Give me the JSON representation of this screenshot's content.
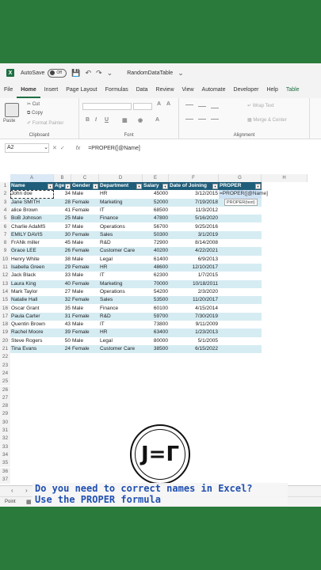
{
  "titlebar": {
    "autosave_label": "AutoSave",
    "autosave_state": "Off",
    "filename": "RandomDataTable"
  },
  "menu": {
    "tabs": [
      "File",
      "Home",
      "Insert",
      "Page Layout",
      "Formulas",
      "Data",
      "Review",
      "View",
      "Automate",
      "Developer",
      "Help",
      "Table"
    ],
    "active": "Home"
  },
  "ribbon": {
    "clipboard": {
      "paste": "Paste",
      "cut": "Cut",
      "copy": "Copy",
      "format_painter": "Format Painter",
      "label": "Clipboard"
    },
    "font": {
      "label": "Font"
    },
    "alignment": {
      "wrap_text": "Wrap Text",
      "merge_center": "Merge & Center",
      "label": "Alignment"
    }
  },
  "formula_bar": {
    "name_box": "A2",
    "fx": "fx",
    "formula": "=PROPER([@Name]"
  },
  "columns": [
    "A",
    "B",
    "C",
    "D",
    "E",
    "F",
    "G",
    "H"
  ],
  "table": {
    "headers": [
      "Name",
      "Age",
      "Gender",
      "Department",
      "Salary",
      "Date of Joining",
      "PROPER"
    ],
    "rows": [
      [
        "John doe",
        "34",
        "Male",
        "HR",
        "45000",
        "3/12/2015",
        "=PROPER([@Name]"
      ],
      [
        "Jane SMITH",
        "28",
        "Female",
        "Marketing",
        "52000",
        "7/19/2018",
        ""
      ],
      [
        "alice Brown",
        "41",
        "Female",
        "IT",
        "68500",
        "11/3/2012",
        ""
      ],
      [
        "BoB Johnson",
        "25",
        "Male",
        "Finance",
        "47800",
        "5/16/2020",
        ""
      ],
      [
        "Charlie AdaMS",
        "37",
        "Male",
        "Operations",
        "56700",
        "9/25/2016",
        ""
      ],
      [
        "EMILY DAVIS",
        "30",
        "Female",
        "Sales",
        "50300",
        "3/1/2019",
        ""
      ],
      [
        "FrANk miller",
        "45",
        "Male",
        "R&D",
        "72900",
        "8/14/2008",
        ""
      ],
      [
        "Grace LEE",
        "26",
        "Female",
        "Customer Care",
        "40200",
        "4/22/2021",
        ""
      ],
      [
        "Henry White",
        "38",
        "Male",
        "Legal",
        "61400",
        "6/9/2013",
        ""
      ],
      [
        "Isabella Green",
        "29",
        "Female",
        "HR",
        "48600",
        "12/10/2017",
        ""
      ],
      [
        "Jack Black",
        "33",
        "Male",
        "IT",
        "62300",
        "1/7/2015",
        ""
      ],
      [
        "Laura King",
        "40",
        "Female",
        "Marketing",
        "70000",
        "10/18/2011",
        ""
      ],
      [
        "Mark Taylor",
        "27",
        "Male",
        "Operations",
        "54200",
        "2/3/2020",
        ""
      ],
      [
        "Natalie Hall",
        "32",
        "Female",
        "Sales",
        "53500",
        "11/20/2017",
        ""
      ],
      [
        "Oscar Grant",
        "35",
        "Male",
        "Finance",
        "60100",
        "4/15/2014",
        ""
      ],
      [
        "Paula Carter",
        "31",
        "Female",
        "R&D",
        "59700",
        "7/30/2019",
        ""
      ],
      [
        "Quentin Brown",
        "43",
        "Male",
        "IT",
        "73800",
        "9/11/2009",
        ""
      ],
      [
        "Rachel Moore",
        "39",
        "Female",
        "HR",
        "63400",
        "1/23/2013",
        ""
      ],
      [
        "Steve Rogers",
        "50",
        "Male",
        "Legal",
        "80000",
        "5/1/2005",
        ""
      ],
      [
        "Tina Evans",
        "24",
        "Female",
        "Customer Care",
        "38500",
        "6/15/2022",
        ""
      ]
    ]
  },
  "row_numbers": [
    "1",
    "2",
    "3",
    "4",
    "5",
    "6",
    "7",
    "8",
    "9",
    "10",
    "11",
    "12",
    "13",
    "14",
    "15",
    "16",
    "17",
    "18",
    "19",
    "20",
    "21",
    "22",
    "23",
    "24",
    "25",
    "26",
    "27",
    "28",
    "29",
    "30",
    "31",
    "32",
    "33",
    "34",
    "35",
    "36",
    "37"
  ],
  "tooltip": "PROPER(text)",
  "status": {
    "mode": "Point"
  },
  "caption": {
    "line1": "Do you need to correct names in Excel?",
    "line2": "Use the PROPER formula"
  },
  "colors": {
    "header": "#1f5e7a",
    "band": "#d6ecf3",
    "background": "#2a7a3c",
    "caption_text": "#1f4fb0"
  }
}
